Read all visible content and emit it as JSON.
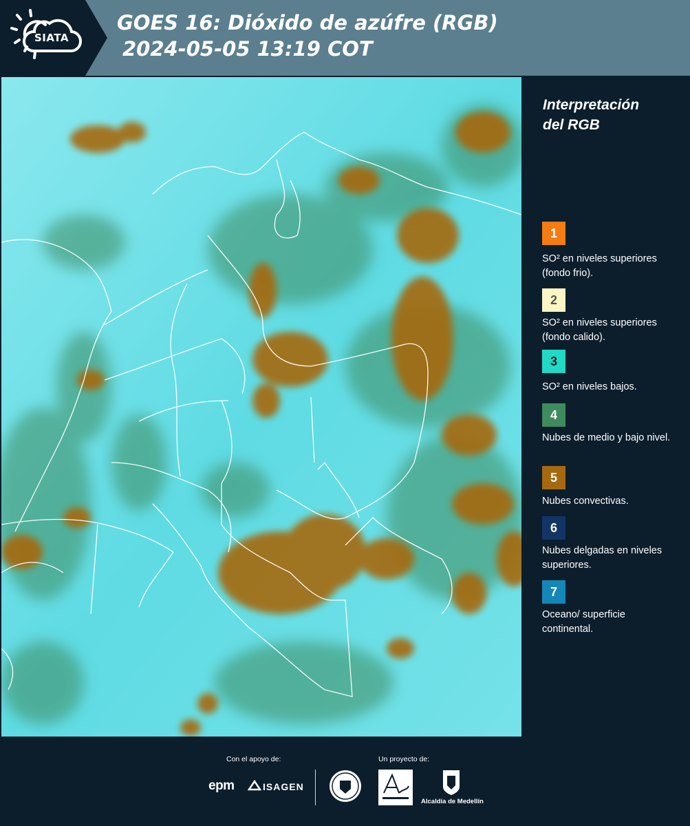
{
  "header": {
    "logo_text": "SIATA",
    "title_line1": "GOES 16: Dióxido de azúfre (RGB)",
    "title_line2": "2024-05-05 13:19 COT"
  },
  "legend": {
    "title_line1": "Interpretación",
    "title_line2": "del RGB",
    "items": [
      {
        "number": "1",
        "color": "#f57c12",
        "text": "SO² en niveles superiores (fondo frio)."
      },
      {
        "number": "2",
        "color": "#fbf6c4",
        "text": "SO² en niveles superiores (fondo calido)."
      },
      {
        "number": "3",
        "color": "#21d9c4",
        "text": "SO² en niveles bajos."
      },
      {
        "number": "4",
        "color": "#3e8b5e",
        "text": "Nubes de medio y bajo nivel."
      },
      {
        "number": "5",
        "color": "#a6690f",
        "text": "Nubes convectivas."
      },
      {
        "number": "6",
        "color": "#123466",
        "text": "Nubes delgadas en niveles superiores."
      },
      {
        "number": "7",
        "color": "#1587b7",
        "text": "Oceano/ superficie continental."
      }
    ]
  },
  "footer": {
    "support_label": "Con el apoyo de:",
    "project_label": "Un proyecto de:",
    "sponsor1": "epm",
    "sponsor2": "ISAGEN",
    "partner_alcaldia": "Alcaldía de Medellín"
  },
  "colors": {
    "background": "#0c1e2c",
    "header_band": "#5b7f8e",
    "map_base": "#6fe0e6",
    "convective": "#a6690f",
    "mid_low_clouds": "#3e8b5e"
  }
}
